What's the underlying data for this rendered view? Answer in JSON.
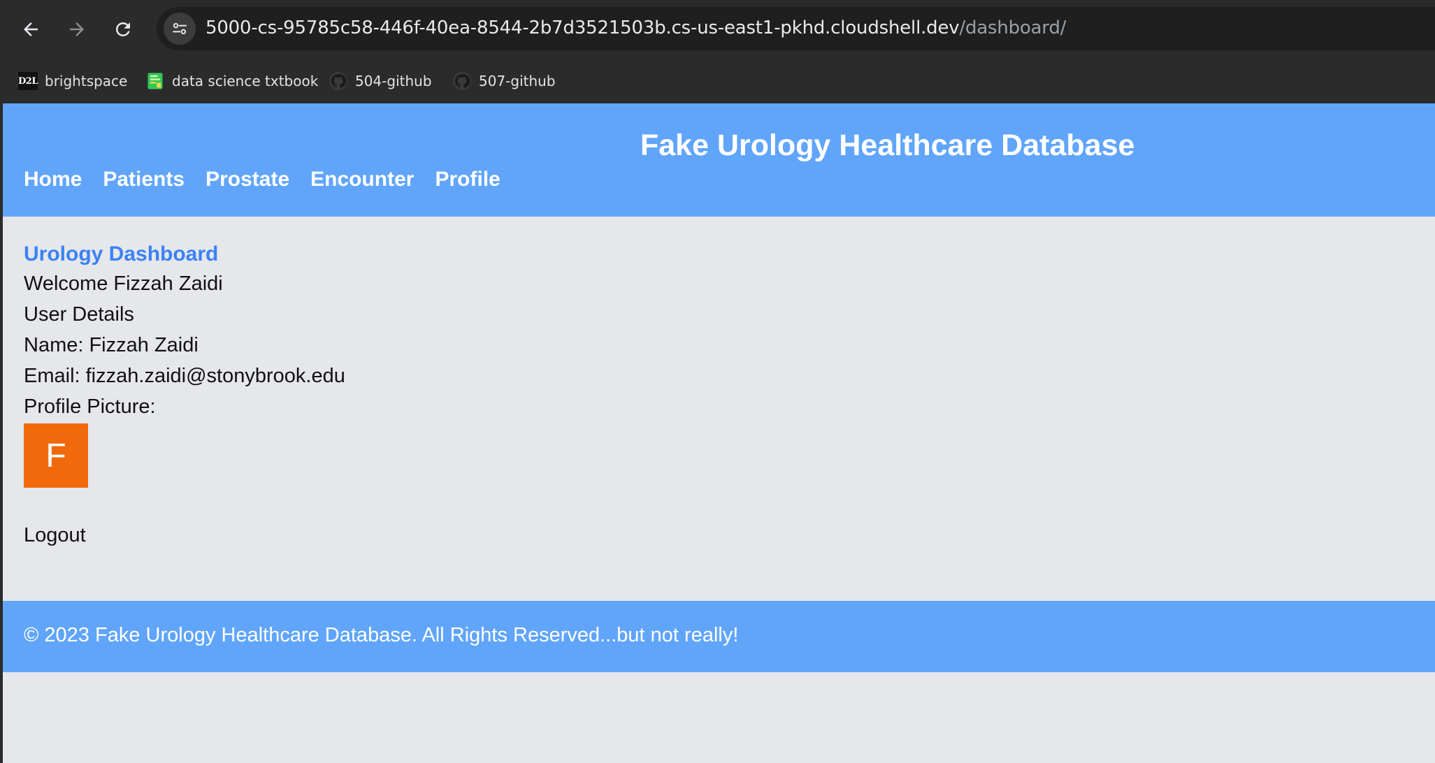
{
  "browser": {
    "url_host": "5000-cs-95785c58-446f-40ea-8544-2b7d3521503b.cs-us-east1-pkhd.cloudshell.dev",
    "url_path": "/dashboard/",
    "bookmarks": [
      {
        "label": "brightspace",
        "icon": "d2l-logo",
        "icon_text": "D2L"
      },
      {
        "label": "data science txtbook",
        "icon": "green-book-icon"
      },
      {
        "label": "504-github",
        "icon": "github-icon"
      },
      {
        "label": "507-github",
        "icon": "github-icon"
      }
    ]
  },
  "header": {
    "title": "Fake Urology Healthcare Database",
    "nav": [
      "Home",
      "Patients",
      "Prostate",
      "Encounter",
      "Profile"
    ],
    "bg_color": "#60a5fa"
  },
  "main": {
    "dashboard_title": "Urology Dashboard",
    "welcome": "Welcome Fizzah Zaidi",
    "user_details_heading": "User Details",
    "name_line": "Name: Fizzah Zaidi",
    "email_line": "Email: fizzah.zaidi@stonybrook.edu",
    "profile_picture_label": "Profile Picture:",
    "avatar_letter": "F",
    "avatar_color": "#f06a0c",
    "logout": "Logout"
  },
  "footer": {
    "text": "© 2023 Fake Urology Healthcare Database. All Rights Reserved...but not really!"
  }
}
